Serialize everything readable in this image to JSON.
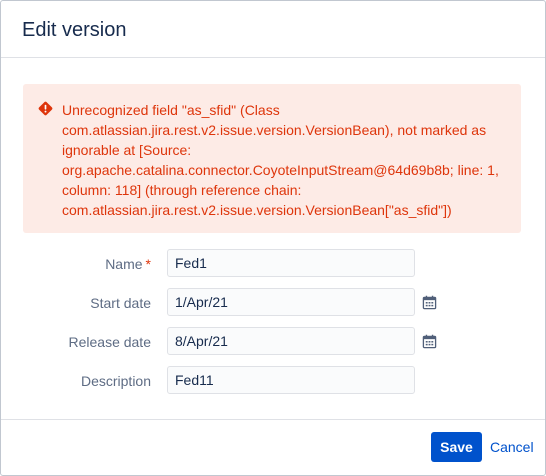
{
  "dialog": {
    "title": "Edit version"
  },
  "error": {
    "lines": [
      "Unrecognized field \"as_sfid\" (Class",
      "com.atlassian.jira.rest.v2.issue.version.VersionBean), not marked as",
      "ignorable at [Source:",
      "org.apache.catalina.connector.CoyoteInputStream@64d69b8b; line: 1,",
      "column: 118] (through reference chain:",
      "com.atlassian.jira.rest.v2.issue.version.VersionBean[\"as_sfid\"])"
    ],
    "icon": "error-icon",
    "color": "#de350b",
    "background": "#fdebe6"
  },
  "form": {
    "name": {
      "label": "Name",
      "required_marker": "*",
      "value": "Fed1"
    },
    "start_date": {
      "label": "Start date",
      "value": "1/Apr/21",
      "icon": "calendar-icon"
    },
    "release_date": {
      "label": "Release date",
      "value": "8/Apr/21",
      "icon": "calendar-icon"
    },
    "description": {
      "label": "Description",
      "value": "Fed11"
    }
  },
  "footer": {
    "save_label": "Save",
    "cancel_label": "Cancel"
  },
  "colors": {
    "primary": "#0052cc",
    "text": "#172b4d",
    "label": "#5e6c84"
  }
}
